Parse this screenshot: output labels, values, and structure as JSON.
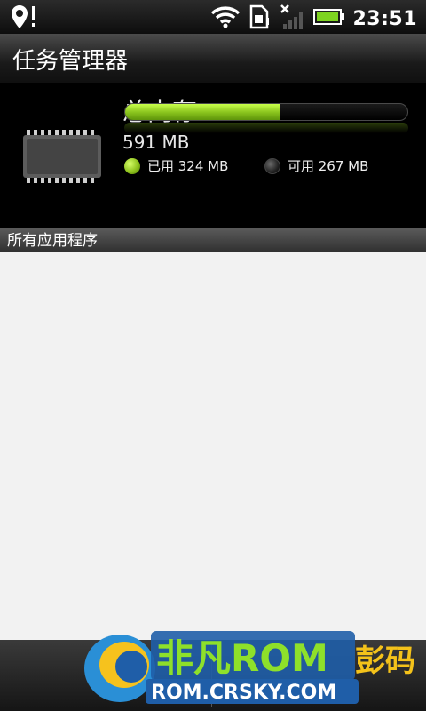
{
  "status_bar": {
    "time": "23:51",
    "icons": [
      "location-alert-icon",
      "wifi-icon",
      "sim-icon",
      "signal-off-icon",
      "battery-icon"
    ]
  },
  "title_bar": {
    "title": "任务管理器"
  },
  "memory": {
    "title": "总内存",
    "total": "591 MB",
    "used_label": "已用 324 MB",
    "free_label": "可用 267 MB",
    "used_fraction": 0.548,
    "used_color": "#8ec11d"
  },
  "section_header": {
    "label": "所有应用程序"
  },
  "watermark": {
    "brand": "非凡ROM",
    "url": "ROM.CRSKY.COM",
    "suffix": "彭码"
  }
}
